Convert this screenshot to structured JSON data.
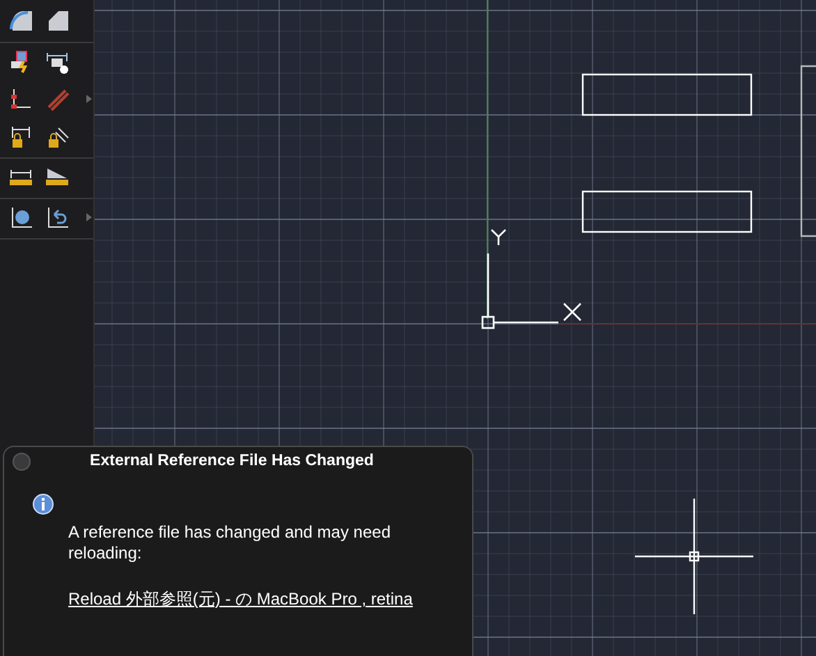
{
  "dialog": {
    "title": "External Reference File Has Changed",
    "message": "A reference file has changed and may need reloading:",
    "link": "Reload 外部参照(元) - の MacBook Pro , retina"
  }
}
